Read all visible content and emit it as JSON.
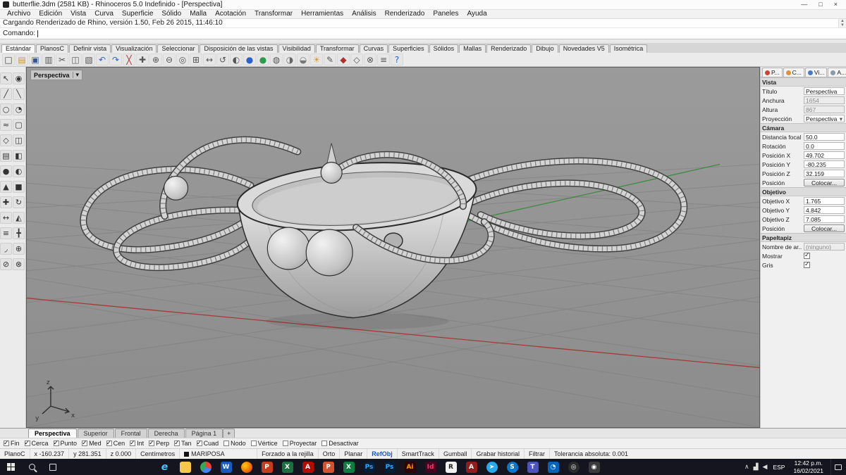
{
  "window": {
    "title": "butterflie.3dm (2581 KB) - Rhinoceros 5.0 Indefinido - [Perspectiva]"
  },
  "menu": {
    "items": [
      "Archivo",
      "Edición",
      "Vista",
      "Curva",
      "Superficie",
      "Sólido",
      "Malla",
      "Acotación",
      "Transformar",
      "Herramientas",
      "Análisis",
      "Renderizado",
      "Paneles",
      "Ayuda"
    ]
  },
  "command": {
    "history": "Cargando Renderizado de Rhino, versión 1.50, Feb 26 2015, 11:46:10",
    "prompt": "Comando:"
  },
  "toolbar_tabs": [
    "Estándar",
    "PlanosC",
    "Definir vista",
    "Visualización",
    "Seleccionar",
    "Disposición de las vistas",
    "Visibilidad",
    "Transformar",
    "Curvas",
    "Superficies",
    "Sólidos",
    "Mallas",
    "Renderizado",
    "Dibujo",
    "Novedades V5",
    "Isométrica"
  ],
  "toolbar": {
    "icons": [
      {
        "g": "□",
        "c": "#444"
      },
      {
        "g": "▤",
        "c": "#c8962e"
      },
      {
        "g": "▣",
        "c": "#33568f"
      },
      {
        "g": "▥",
        "c": "#555"
      },
      {
        "g": "✂",
        "c": "#555"
      },
      {
        "g": "◫",
        "c": "#555"
      },
      {
        "g": "▧",
        "c": "#555"
      },
      {
        "g": "↶",
        "c": "#2a62c9"
      },
      {
        "g": "↷",
        "c": "#2a62c9"
      },
      {
        "g": "╳",
        "c": "#b03030"
      },
      {
        "g": "✚",
        "c": "#555"
      },
      {
        "g": "⊕",
        "c": "#555"
      },
      {
        "g": "⊖",
        "c": "#555"
      },
      {
        "g": "◎",
        "c": "#555"
      },
      {
        "g": "⊞",
        "c": "#555"
      },
      {
        "g": "↔",
        "c": "#555"
      },
      {
        "g": "↺",
        "c": "#555"
      },
      {
        "g": "◐",
        "c": "#555"
      },
      {
        "g": "●",
        "c": "#2a62c9"
      },
      {
        "g": "●",
        "c": "#2a9d4a"
      },
      {
        "g": "◍",
        "c": "#555"
      },
      {
        "g": "◑",
        "c": "#666"
      },
      {
        "g": "◒",
        "c": "#777"
      },
      {
        "g": "☀",
        "c": "#d99a2b"
      },
      {
        "g": "✎",
        "c": "#555"
      },
      {
        "g": "◆",
        "c": "#b03030"
      },
      {
        "g": "◇",
        "c": "#555"
      },
      {
        "g": "⊗",
        "c": "#555"
      },
      {
        "g": "≡",
        "c": "#555"
      },
      {
        "g": "?",
        "c": "#2a62c9"
      }
    ]
  },
  "left_tools": [
    "↖",
    "◉",
    "╱",
    "╲",
    "○",
    "◔",
    "≈",
    "▢",
    "◇",
    "◫",
    "▤",
    "◧",
    "●",
    "◐",
    "▲",
    "■",
    "✚",
    "↻",
    "↔",
    "◭",
    "≡",
    "╋",
    "◞",
    "⊕",
    "⊘",
    "⊗"
  ],
  "viewport": {
    "title": "Perspectiva",
    "axis_x": "x",
    "axis_y": "y",
    "axis_z": "z"
  },
  "panel": {
    "tabs": [
      {
        "label": "P...",
        "color": "#cc4433"
      },
      {
        "label": "C...",
        "color": "#e09035"
      },
      {
        "label": "Vi...",
        "color": "#4b79c9"
      },
      {
        "label": "A...",
        "color": "#8a9aa8"
      }
    ],
    "rows": [
      {
        "t": "hdr",
        "label": "Vista"
      },
      {
        "t": "text",
        "label": "Título",
        "value": "Perspectiva"
      },
      {
        "t": "ro",
        "label": "Anchura",
        "value": "1654"
      },
      {
        "t": "ro",
        "label": "Altura",
        "value": "867"
      },
      {
        "t": "select",
        "label": "Proyección",
        "value": "Perspectiva"
      },
      {
        "t": "hdr",
        "label": "Cámara"
      },
      {
        "t": "text",
        "label": "Distancia focal",
        "value": "50.0"
      },
      {
        "t": "text",
        "label": "Rotación",
        "value": "0.0"
      },
      {
        "t": "text",
        "label": "Posición X",
        "value": "49.702"
      },
      {
        "t": "text",
        "label": "Posición Y",
        "value": "-80.235"
      },
      {
        "t": "text",
        "label": "Posición Z",
        "value": "32.159"
      },
      {
        "t": "button",
        "label": "Posición",
        "value": "Colocar..."
      },
      {
        "t": "hdr",
        "label": "Objetivo"
      },
      {
        "t": "text",
        "label": "Objetivo X",
        "value": "1.765"
      },
      {
        "t": "text",
        "label": "Objetivo Y",
        "value": "4.842"
      },
      {
        "t": "text",
        "label": "Objetivo Z",
        "value": "7.085"
      },
      {
        "t": "button",
        "label": "Posición",
        "value": "Colocar..."
      },
      {
        "t": "hdr",
        "label": "Papeltapiz"
      },
      {
        "t": "ro",
        "label": "Nombre de ar...",
        "value": "(ninguno)"
      },
      {
        "t": "check",
        "label": "Mostrar",
        "checked": true
      },
      {
        "t": "check",
        "label": "Gris",
        "checked": true
      }
    ]
  },
  "viewport_tabs": [
    {
      "label": "Perspectiva",
      "active": true
    },
    {
      "label": "Superior",
      "active": false
    },
    {
      "label": "Frontal",
      "active": false
    },
    {
      "label": "Derecha",
      "active": false
    },
    {
      "label": "Página 1",
      "active": false
    }
  ],
  "viewport_tabs_add": "+",
  "osnap": {
    "items": [
      {
        "label": "Fin",
        "on": true
      },
      {
        "label": "Cerca",
        "on": true
      },
      {
        "label": "Punto",
        "on": true
      },
      {
        "label": "Med",
        "on": true
      },
      {
        "label": "Cen",
        "on": true
      },
      {
        "label": "Int",
        "on": true
      },
      {
        "label": "Perp",
        "on": true
      },
      {
        "label": "Tan",
        "on": true
      },
      {
        "label": "Cuad",
        "on": true
      },
      {
        "label": "Nodo",
        "on": false
      },
      {
        "label": "Vértice",
        "on": false
      },
      {
        "label": "Proyectar",
        "on": false
      },
      {
        "label": "Desactivar",
        "on": false
      }
    ]
  },
  "statusbar": {
    "items": [
      {
        "text": "PlanoC"
      },
      {
        "text": "x -160.237"
      },
      {
        "text": "y 281.351"
      },
      {
        "text": "z 0.000"
      },
      {
        "text": "Centímetros"
      },
      {
        "text": "MARIPOSA",
        "cls": "swatch"
      },
      {
        "text": "Forzado a la rejilla"
      },
      {
        "text": "Orto"
      },
      {
        "text": "Planar"
      },
      {
        "text": "RefObj",
        "cls": "hl"
      },
      {
        "text": "SmartTrack"
      },
      {
        "text": "Gumball"
      },
      {
        "text": "Grabar historial"
      },
      {
        "text": "Filtrar"
      },
      {
        "text": "Tolerancia absoluta: 0.001",
        "cls": "plain"
      }
    ]
  },
  "taskbar": {
    "lang": "ESP",
    "time": "12:42 p.m.",
    "date": "16/02/2021",
    "apps": [
      {
        "name": "edge",
        "letter": "e",
        "bg": "transparent",
        "fg": "#4cc2ff",
        "shape": "big"
      },
      {
        "name": "file-explorer",
        "letter": "",
        "bg": "#f8c74a",
        "fg": "#ffffff"
      },
      {
        "name": "chrome",
        "letter": "",
        "bg": "conic-gradient(#ea4335 0 30%, #4285f4 30% 63%, #34a853 63% 100%)",
        "fg": "#ffffff",
        "shape": "circle"
      },
      {
        "name": "word",
        "letter": "W",
        "bg": "#185abd",
        "fg": "#ffffff"
      },
      {
        "name": "firefox",
        "letter": "",
        "bg": "radial-gradient(circle at 35% 35%, #ffcb00, #e8590c 70%)",
        "fg": "#ffffff",
        "shape": "circle"
      },
      {
        "name": "powerpoint",
        "letter": "P",
        "bg": "#c43e1c",
        "fg": "#ffffff"
      },
      {
        "name": "excel",
        "letter": "X",
        "bg": "#1d6f42",
        "fg": "#ffffff"
      },
      {
        "name": "acrobat",
        "letter": "A",
        "bg": "#b30b00",
        "fg": "#ffffff"
      },
      {
        "name": "powerpoint-doc",
        "letter": "P",
        "bg": "#d35230",
        "fg": "#ffffff"
      },
      {
        "name": "excel-doc",
        "letter": "X",
        "bg": "#107c41",
        "fg": "#ffffff"
      },
      {
        "name": "photoshop",
        "letter": "Ps",
        "bg": "#001e36",
        "fg": "#31a8ff"
      },
      {
        "name": "photoshop-2",
        "letter": "Ps",
        "bg": "#001e36",
        "fg": "#31a8ff"
      },
      {
        "name": "illustrator",
        "letter": "Ai",
        "bg": "#330000",
        "fg": "#ff9a00"
      },
      {
        "name": "indesign",
        "letter": "Id",
        "bg": "#49021f",
        "fg": "#ff3366"
      },
      {
        "name": "rhino",
        "letter": "R",
        "bg": "#f2f2f2",
        "fg": "#222222"
      },
      {
        "name": "autocad",
        "letter": "A",
        "bg": "#8f1d1d",
        "fg": "#ffffff"
      },
      {
        "name": "telegram",
        "letter": "➤",
        "bg": "#29a9eb",
        "fg": "#ffffff",
        "shape": "circle"
      },
      {
        "name": "skype",
        "letter": "S",
        "bg": "#0078d4",
        "fg": "#ffffff",
        "shape": "circle"
      },
      {
        "name": "teams",
        "letter": "T",
        "bg": "#4b53bc",
        "fg": "#ffffff"
      },
      {
        "name": "onedrive",
        "letter": "◔",
        "bg": "#0364b8",
        "fg": "#ffffff"
      },
      {
        "name": "obs",
        "letter": "◎",
        "bg": "#2b2b2b",
        "fg": "#ffffff",
        "shape": "circle"
      },
      {
        "name": "camera",
        "letter": "◉",
        "bg": "#3a3a3a",
        "fg": "#ffffff"
      }
    ]
  }
}
